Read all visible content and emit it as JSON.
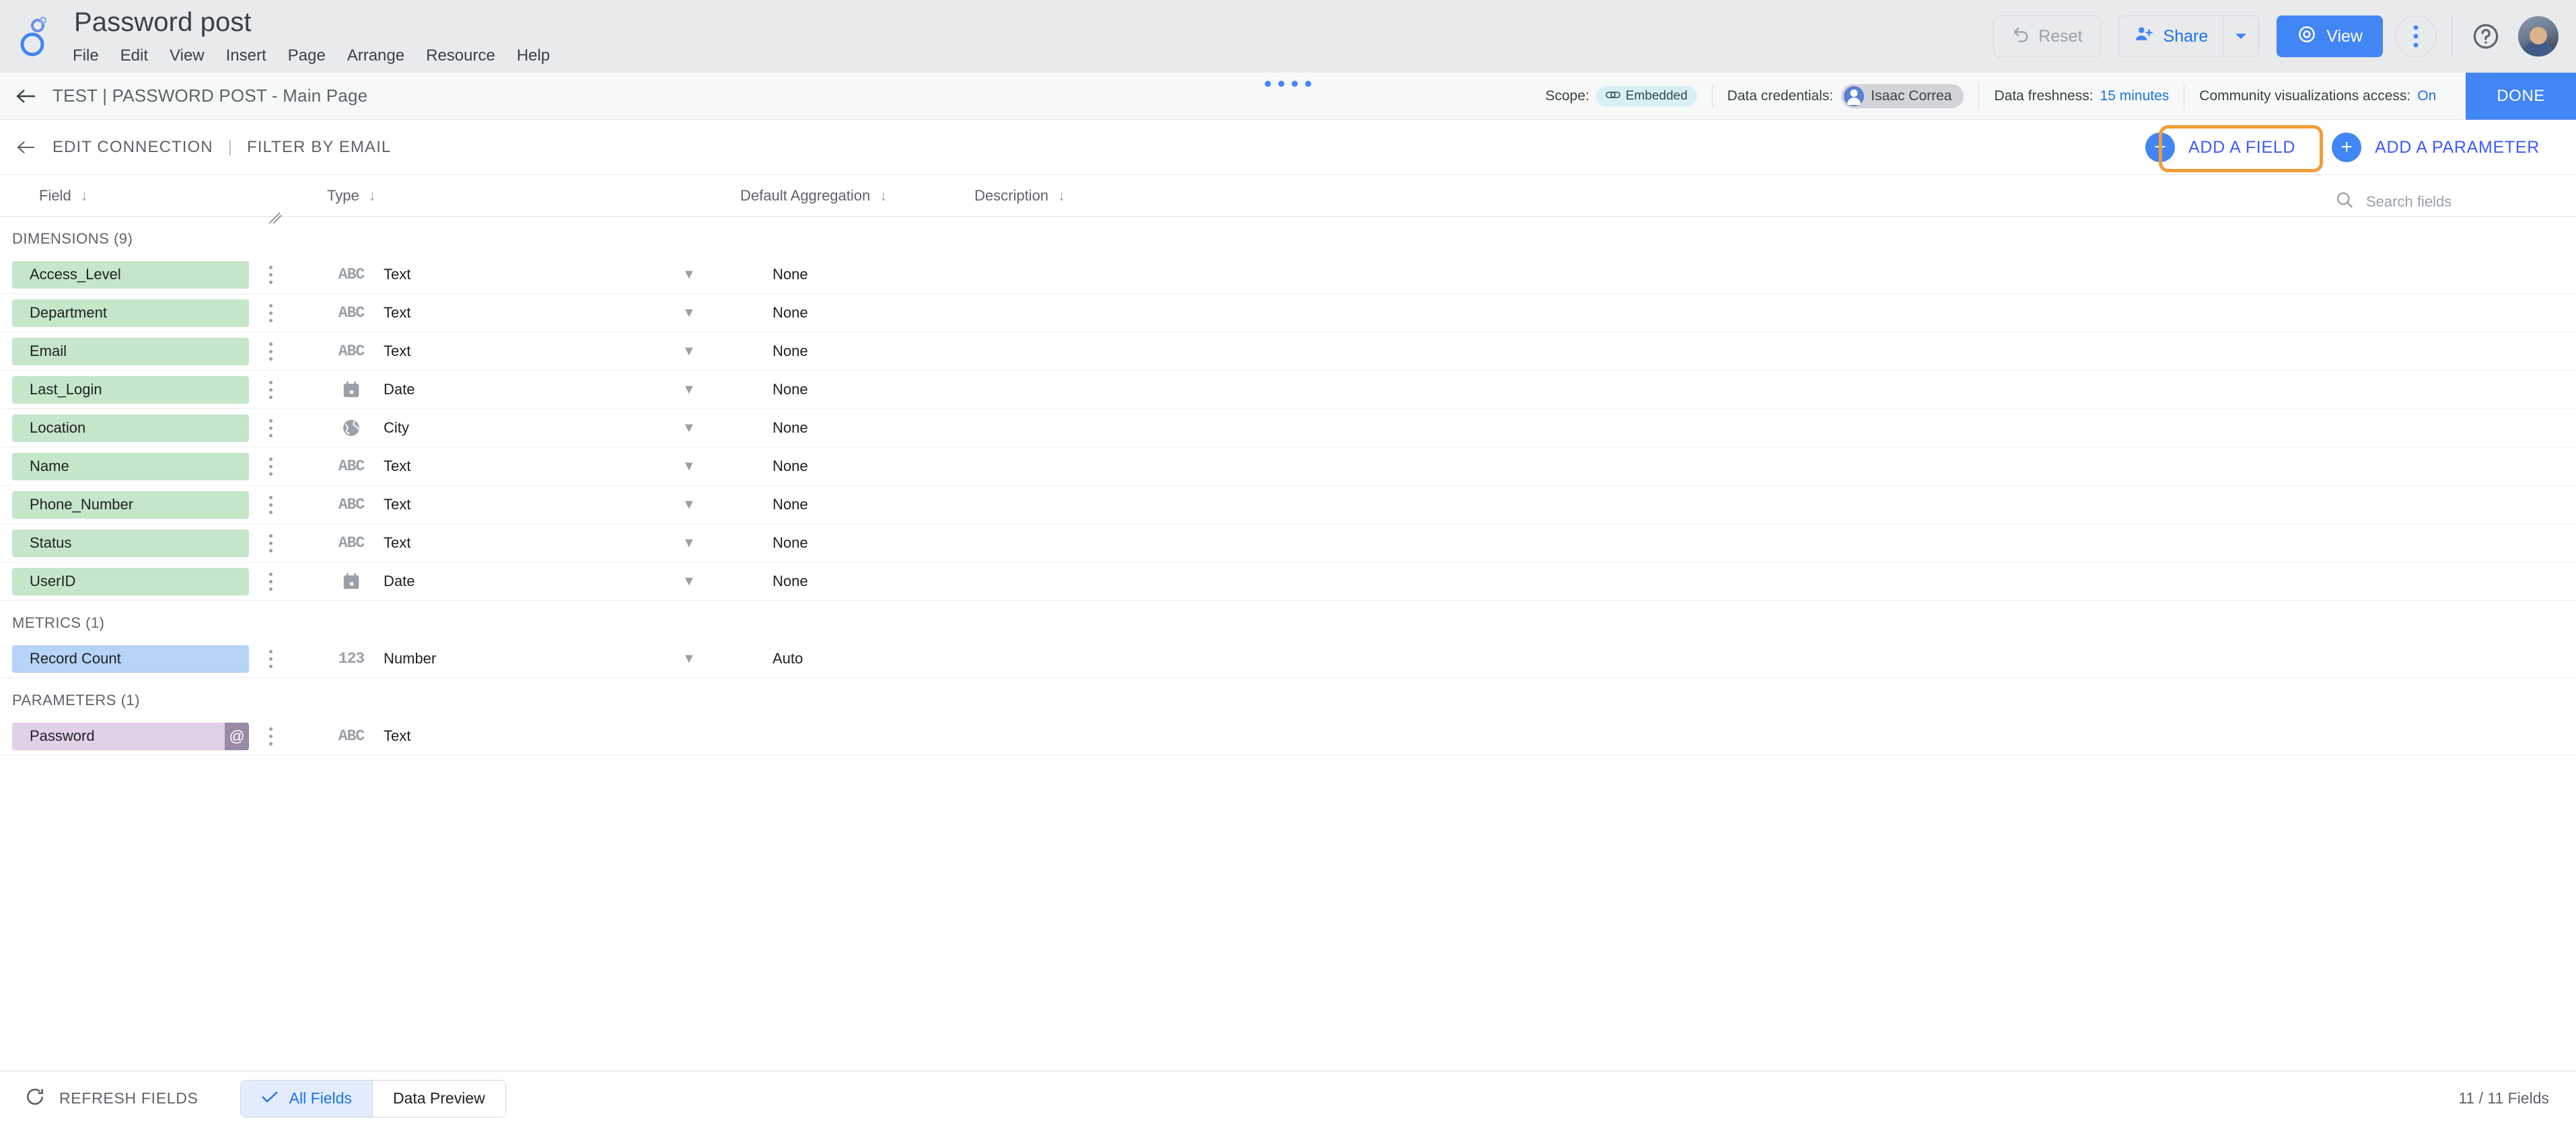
{
  "app": {
    "doc_title": "Password post",
    "menu": [
      "File",
      "Edit",
      "View",
      "Insert",
      "Page",
      "Arrange",
      "Resource",
      "Help"
    ],
    "accent_blue": "#4285f4",
    "link_blue": "#1a73e8",
    "highlight_orange": "#f29d38"
  },
  "toolbar": {
    "reset_label": "Reset",
    "share_label": "Share",
    "view_label": "View",
    "more_icon": "kebab-menu-icon",
    "help_icon": "help-circle-icon",
    "avatar_icon": "user-avatar"
  },
  "pagebar": {
    "back_icon": "arrow-left-icon",
    "title": "TEST | PASSWORD POST - Main Page",
    "scope_label": "Scope:",
    "scope_value": "Embedded",
    "credentials_label": "Data credentials:",
    "credentials_value": "Isaac Correa",
    "freshness_label": "Data freshness:",
    "freshness_value": "15 minutes",
    "community_label": "Community visualizations access:",
    "community_value": "On",
    "done_label": "DONE"
  },
  "connbar": {
    "back_icon": "arrow-left-icon",
    "edit_connection": "EDIT CONNECTION",
    "separator": "|",
    "filter_by_email": "FILTER BY EMAIL",
    "add_field": "ADD A FIELD",
    "add_parameter": "ADD A PARAMETER"
  },
  "table": {
    "headers": {
      "field": "Field",
      "type": "Type",
      "aggregation": "Default Aggregation",
      "description": "Description"
    },
    "search_placeholder": "Search fields",
    "search_value": ""
  },
  "sections": [
    {
      "label": "DIMENSIONS (9)",
      "chip_class": "chip-dim",
      "rows": [
        {
          "name": "Access_Level",
          "type_icon": "ABC",
          "type": "Text",
          "agg": "None"
        },
        {
          "name": "Department",
          "type_icon": "ABC",
          "type": "Text",
          "agg": "None"
        },
        {
          "name": "Email",
          "type_icon": "ABC",
          "type": "Text",
          "agg": "None"
        },
        {
          "name": "Last_Login",
          "type_icon": "date",
          "type": "Date",
          "agg": "None"
        },
        {
          "name": "Location",
          "type_icon": "globe",
          "type": "City",
          "agg": "None"
        },
        {
          "name": "Name",
          "type_icon": "ABC",
          "type": "Text",
          "agg": "None"
        },
        {
          "name": "Phone_Number",
          "type_icon": "ABC",
          "type": "Text",
          "agg": "None"
        },
        {
          "name": "Status",
          "type_icon": "ABC",
          "type": "Text",
          "agg": "None"
        },
        {
          "name": "UserID",
          "type_icon": "date",
          "type": "Date",
          "agg": "None"
        }
      ]
    },
    {
      "label": "METRICS (1)",
      "chip_class": "chip-met",
      "rows": [
        {
          "name": "Record Count",
          "type_icon": "123",
          "type": "Number",
          "agg": "Auto"
        }
      ]
    },
    {
      "label": "PARAMETERS (1)",
      "chip_class": "chip-par",
      "rows": [
        {
          "name": "Password",
          "type_icon": "ABC",
          "type": "Text",
          "agg": "",
          "badge": "@"
        }
      ]
    }
  ],
  "bottombar": {
    "refresh_label": "REFRESH FIELDS",
    "tab_all_fields": "All Fields",
    "tab_data_preview": "Data Preview",
    "fields_count": "11 / 11 Fields"
  }
}
